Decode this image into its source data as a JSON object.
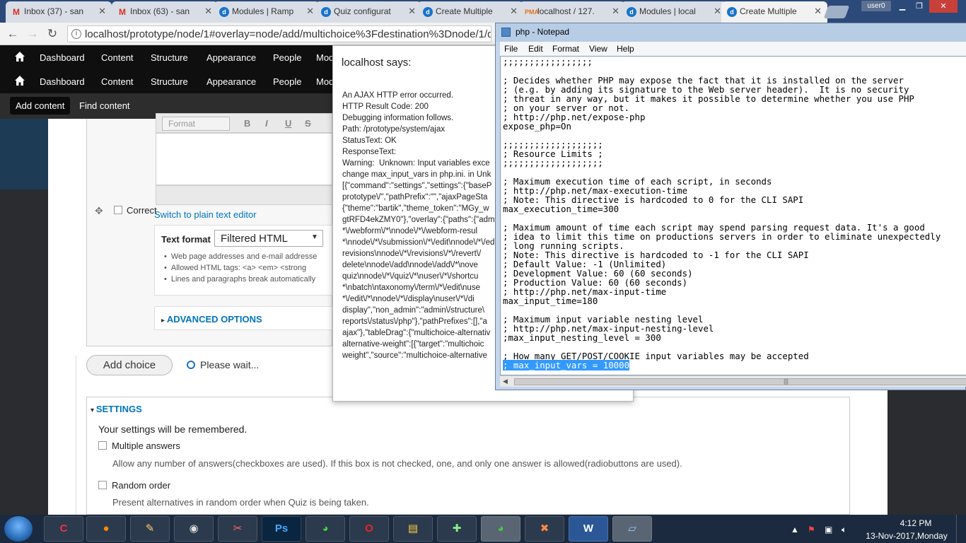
{
  "browser": {
    "tabs": [
      {
        "label": "Inbox (37) - san",
        "icon": "gmail-icon"
      },
      {
        "label": "Inbox (63) - san",
        "icon": "gmail-icon"
      },
      {
        "label": "Modules | Ramp",
        "icon": "drupal-icon"
      },
      {
        "label": "Quiz configurat",
        "icon": "drupal-icon"
      },
      {
        "label": "Create Multiple",
        "icon": "drupal-icon"
      },
      {
        "label": "localhost / 127.",
        "icon": "phpmyadmin-icon"
      },
      {
        "label": "Modules | local",
        "icon": "drupal-icon"
      },
      {
        "label": "Create Multiple",
        "icon": "drupal-icon"
      }
    ],
    "user": "user0",
    "url": "localhost/prototype/node/1#overlay=node/add/multichoice%3Fdestination%3Dnode/1/quiz/q"
  },
  "admin": {
    "menu": [
      "Dashboard",
      "Content",
      "Structure",
      "Appearance",
      "People",
      "Mod"
    ],
    "shortcuts": [
      "Add content",
      "Find content"
    ]
  },
  "form": {
    "editor_format": "Format",
    "correct_label": "Correct",
    "switch_editor": "Switch to plain text editor",
    "text_format_label": "Text format",
    "text_format_value": "Filtered HTML",
    "format_tips": [
      "Web page addresses and e-mail addresse",
      "Allowed HTML tags: <a> <em> <strong",
      "Lines and paragraphs break automatically"
    ],
    "advanced_options": "ADVANCED OPTIONS",
    "add_choice": "Add choice",
    "please_wait": "Please wait...",
    "settings_title": "SETTINGS",
    "settings_note": "Your settings will be remembered.",
    "multiple_answers": "Multiple answers",
    "multiple_answers_desc": "Allow any number of answers(checkboxes are used). If this box is not checked, one, and only one answer is allowed(radiobuttons are used).",
    "random_order": "Random order",
    "random_order_desc": "Present alternatives in random order when Quiz is being taken."
  },
  "alert": {
    "title": "localhost says:",
    "body": "An AJAX HTTP error occurred.\nHTTP Result Code: 200\nDebugging information follows.\nPath: /prototype/system/ajax\nStatusText: OK\nResponseText:\nWarning:  Unknown: Input variables exce\nchange max_input_vars in php.ini. in Unk\n[{\"command\":\"settings\",\"settings\":{\"baseP\nprototype\\/\",\"pathPrefix\":\"\",\"ajaxPageSta\n{\"theme\":\"bartik\",\"theme_token\":\"MGy_w\ngtRFD4ekZMY0\"},\"overlay\":{\"paths\":{\"adm\n*\\/webform\\/*\\nnode\\/*\\/webform-resul\n*\\nnode\\/*\\/submission\\/*\\/edit\\nnode\\/*\\/ed\nrevisions\\nnode\\/*\\/revisions\\/*\\/revert\\/\ndelete\\nnode\\/add\\nnode\\/add\\/*\\nove\nquiz\\nnode\\/*\\/quiz\\/*\\nuser\\/*\\/shortcu\n*\\nbatch\\ntaxonomy\\/term\\/*\\/edit\\nuse\n*\\/edit\\/*\\nnode\\/*\\/display\\nuser\\/*\\/di\ndisplay\",\"non_admin\":\"admin\\/structure\\\nreports\\/status\\/php\"},\"pathPrefixes\":[],\"a\najax\"},\"tableDrag\":{\"multichoice-alternativ\nalternative-weight\":[{\"target\":\"multichoic\nweight\",\"source\":\"multichoice-alternative"
  },
  "notepad": {
    "title": "php - Notepad",
    "menu": [
      "File",
      "Edit",
      "Format",
      "View",
      "Help"
    ],
    "text_before": ";;;;;;;;;;;;;;;;;\n\n; Decides whether PHP may expose the fact that it is installed on the server\n; (e.g. by adding its signature to the Web server header).  It is no security\n; threat in any way, but it makes it possible to determine whether you use PHP\n; on your server or not.\n; http://php.net/expose-php\nexpose_php=On\n\n;;;;;;;;;;;;;;;;;;;\n; Resource Limits ;\n;;;;;;;;;;;;;;;;;;;\n\n; Maximum execution time of each script, in seconds\n; http://php.net/max-execution-time\n; Note: This directive is hardcoded to 0 for the CLI SAPI\nmax_execution_time=300\n\n; Maximum amount of time each script may spend parsing request data. It's a good\n; idea to limit this time on productions servers in order to eliminate unexpectedly\n; long running scripts.\n; Note: This directive is hardcoded to -1 for the CLI SAPI\n; Default Value: -1 (Unlimited)\n; Development Value: 60 (60 seconds)\n; Production Value: 60 (60 seconds)\n; http://php.net/max-input-time\nmax_input_time=180\n\n; Maximum input variable nesting level\n; http://php.net/max-input-nesting-level\n;max_input_nesting_level = 300\n\n; How many GET/POST/COOKIE input variables may be accepted\n",
    "line_prefix": "; ",
    "selected_text": "max_input_vars = 10000"
  },
  "taskbar": {
    "apps": [
      "CCleaner",
      "Firefox",
      "Paint",
      "Camera",
      "Snipping",
      "Ps",
      "Chrome",
      "Opera",
      "Explorer",
      "Notepad++",
      "Chrome User",
      "XAMPP",
      "W",
      "Notepad"
    ],
    "time": "4:12 PM",
    "date": "13-Nov-2017,Monday"
  }
}
